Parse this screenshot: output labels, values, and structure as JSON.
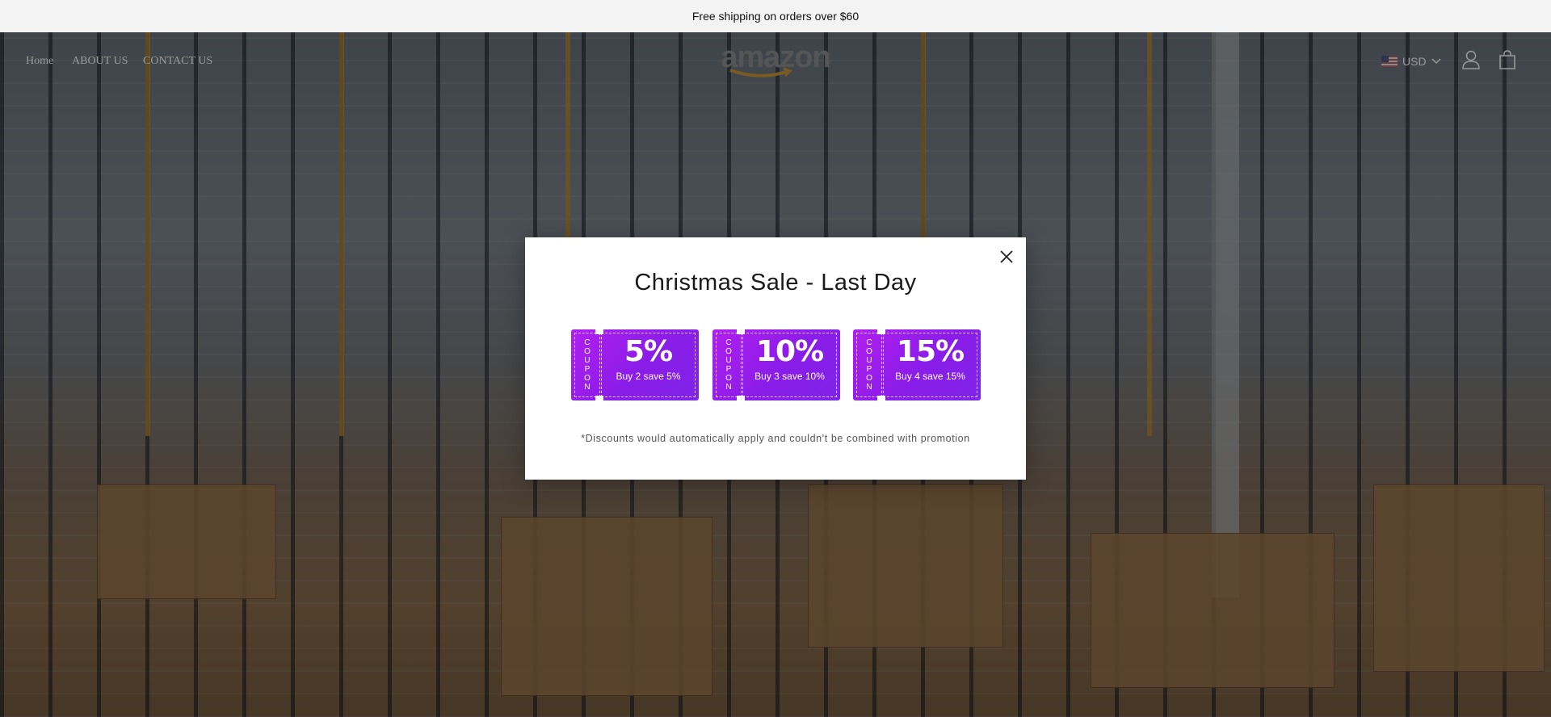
{
  "announcement": "Free shipping on orders over $60",
  "nav": {
    "links": [
      "Home",
      "ABOUT US",
      "CONTACT US"
    ],
    "logo_text": "amazon",
    "currency": "USD"
  },
  "icons": {
    "flag": "us-flag-icon",
    "account": "user-icon",
    "cart": "shopping-bag-icon",
    "close": "close-icon",
    "dropdown": "chevron-down-icon"
  },
  "popup": {
    "title": "Christmas Sale - Last Day",
    "coupons": [
      {
        "stub_letters": [
          "C",
          "O",
          "U",
          "P",
          "O",
          "N"
        ],
        "discount": "5%",
        "description": "Buy 2 save 5%"
      },
      {
        "stub_letters": [
          "C",
          "O",
          "U",
          "P",
          "O",
          "N"
        ],
        "discount": "10%",
        "description": "Buy 3 save 10%"
      },
      {
        "stub_letters": [
          "C",
          "O",
          "U",
          "P",
          "O",
          "N"
        ],
        "discount": "15%",
        "description": "Buy 4 save 15%"
      }
    ],
    "disclaimer": "*Discounts would automatically apply and couldn't be combined with promotion"
  },
  "colors": {
    "coupon_gradient_start": "#b11ef0",
    "coupon_gradient_end": "#7f24e8",
    "announcement_bg": "#f3f3f3",
    "overlay": "rgba(0,0,0,0.5)"
  }
}
